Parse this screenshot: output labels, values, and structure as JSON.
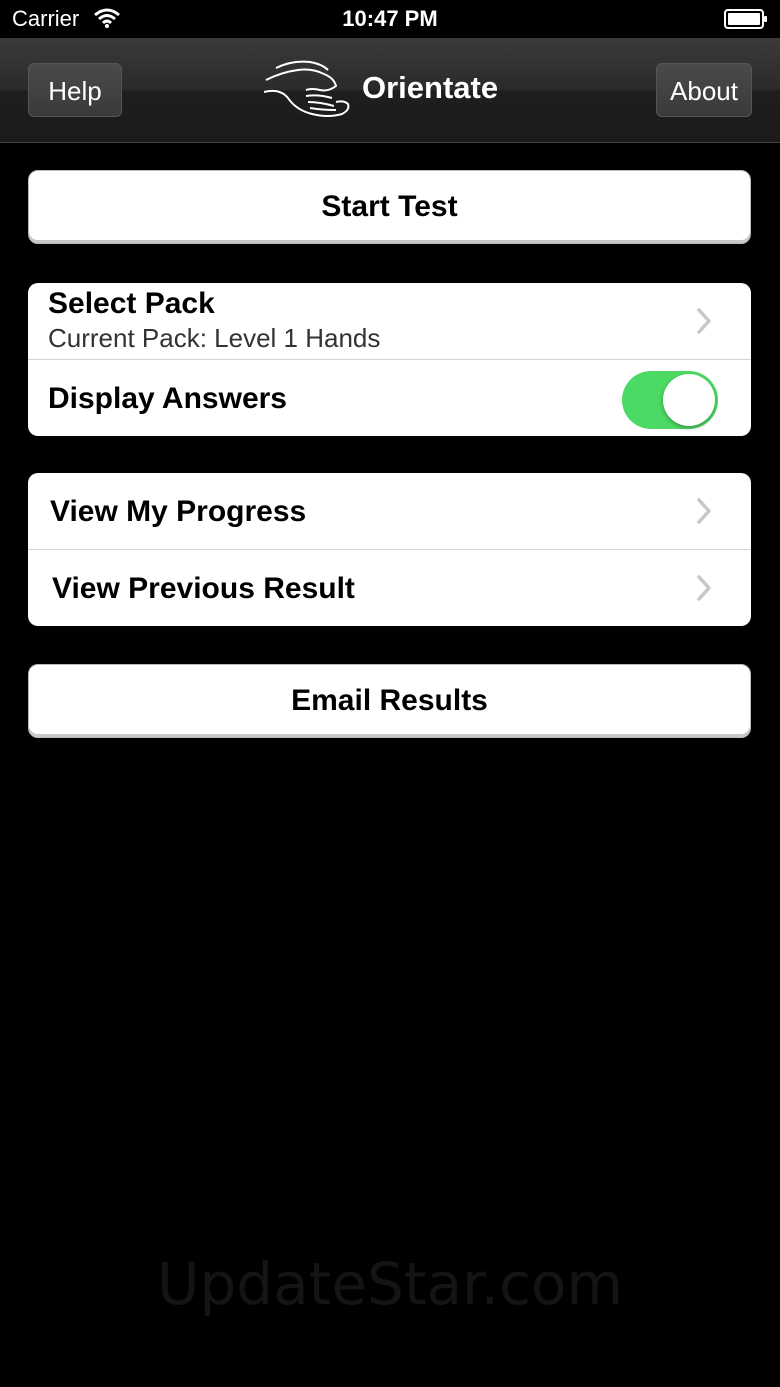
{
  "status_bar": {
    "carrier": "Carrier",
    "time": "10:47 PM",
    "wifi_icon": "wifi-icon",
    "battery_icon": "battery-icon"
  },
  "nav": {
    "title": "Orientate",
    "left_button": "Help",
    "right_button": "About",
    "logo_icon": "hands-logo-icon"
  },
  "main": {
    "start_test": "Start Test",
    "settings_group": {
      "select_pack_title": "Select Pack",
      "select_pack_subtitle": "Current Pack: Level 1 Hands",
      "display_answers_label": "Display Answers",
      "display_answers_on": true
    },
    "progress_group": {
      "view_progress": "View My Progress",
      "view_previous": "View Previous Result"
    },
    "email_results": "Email Results"
  },
  "watermark": "UpdateStar.com",
  "colors": {
    "toggle_on": "#4cd964",
    "background": "#000000"
  }
}
